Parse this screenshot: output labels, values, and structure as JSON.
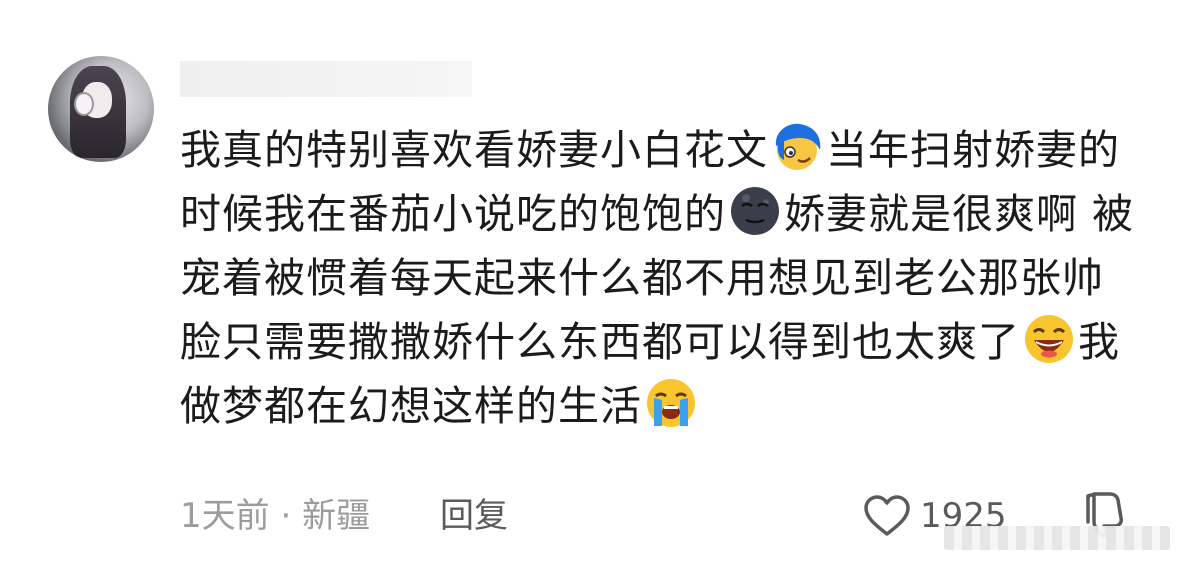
{
  "comment": {
    "text_segments": [
      "我真的特别喜欢看娇妻小白花文",
      "当年扫射娇妻的时候我在番茄小说吃的饱饱的",
      "娇妻就是很爽啊 被宠着被惯着每天起来什么都不用想见到老公那张帅脸只需要撒撒娇什么东西都可以得到也太爽了",
      "我做梦都在幻想这样的生活"
    ],
    "emojis": [
      "blue-hair-grin-emoji",
      "dark-moon-face-emoji",
      "grinning-squint-emoji",
      "loudly-crying-emoji"
    ],
    "time": "1天前",
    "separator": " · ",
    "location": "新疆",
    "reply_label": "回复",
    "like_count": "1925"
  },
  "colors": {
    "text": "#1b1b1b",
    "meta": "#9c9c9c",
    "action": "#5a5a5a"
  }
}
